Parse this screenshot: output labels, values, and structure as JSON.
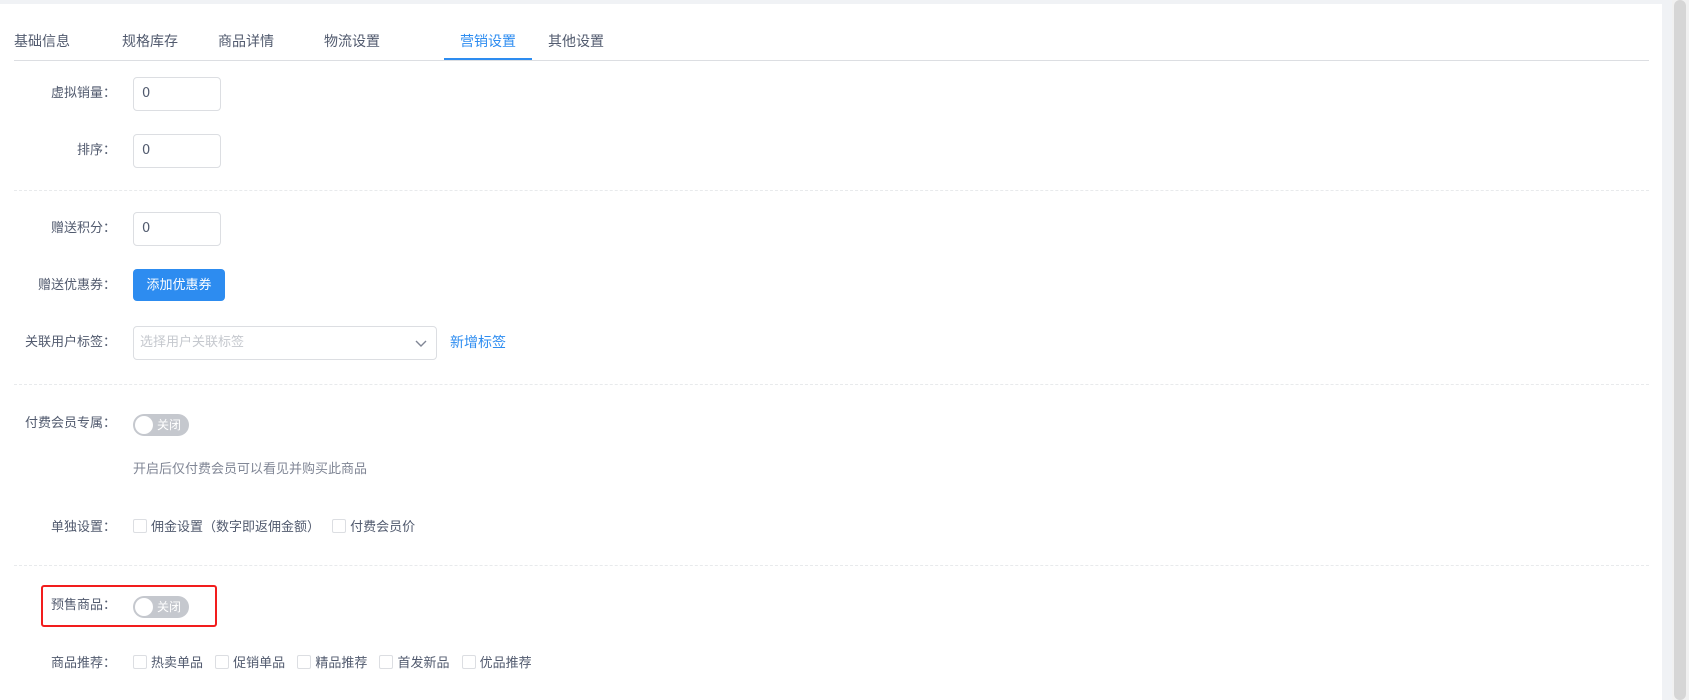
{
  "tabs": [
    {
      "label": "基础信息",
      "active": false
    },
    {
      "label": "规格库存",
      "active": false
    },
    {
      "label": "商品详情",
      "active": false
    },
    {
      "label": "物流设置",
      "active": false
    },
    {
      "label": "营销设置",
      "active": true
    },
    {
      "label": "其他设置",
      "active": false
    }
  ],
  "form": {
    "virtual_sales": {
      "label": "虚拟销量：",
      "value": "0"
    },
    "sort": {
      "label": "排序：",
      "value": "0"
    },
    "gift_points": {
      "label": "赠送积分：",
      "value": "0"
    },
    "gift_coupon": {
      "label": "赠送优惠券：",
      "button": "添加优惠券"
    },
    "user_tag": {
      "label": "关联用户标签：",
      "placeholder": "选择用户关联标签",
      "link": "新增标签"
    },
    "paid_member_only": {
      "label": "付费会员专属：",
      "switch_text": "关闭",
      "on": false,
      "hint": "开启后仅付费会员可以看见并购买此商品"
    },
    "separate_settings": {
      "label": "单独设置：",
      "options": [
        "佣金设置（数字即返佣金额）",
        "付费会员价"
      ]
    },
    "presale": {
      "label": "预售商品：",
      "switch_text": "关闭",
      "on": false
    },
    "recommend": {
      "label": "商品推荐：",
      "options": [
        "热卖单品",
        "促销单品",
        "精品推荐",
        "首发新品",
        "优品推荐"
      ]
    }
  },
  "colors": {
    "primary": "#2d8cf0",
    "highlight": "#f21d1d",
    "switch_off": "#c5c8ce"
  }
}
